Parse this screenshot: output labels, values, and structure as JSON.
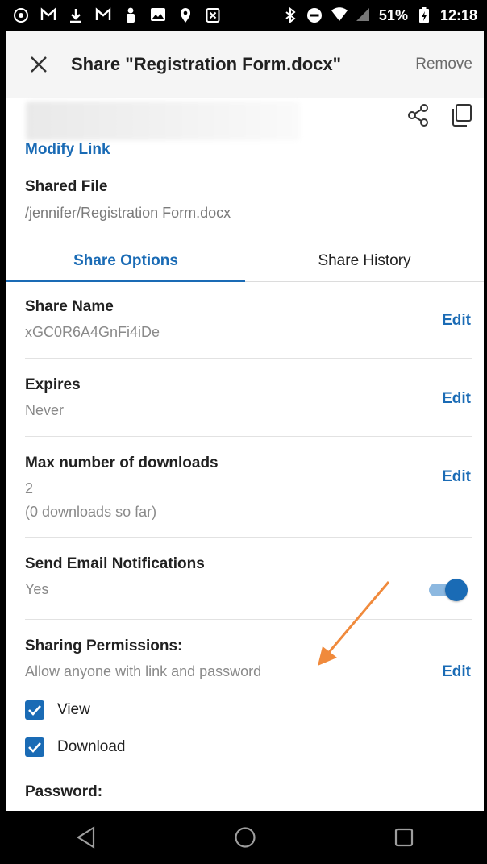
{
  "status_bar": {
    "battery": "51%",
    "time": "12:18",
    "left_icons": [
      "whatsapp-icon",
      "gmail-icon",
      "download-icon",
      "gmail-icon",
      "person-icon",
      "image-icon",
      "location-icon",
      "close-box-icon"
    ],
    "right_icons": [
      "bluetooth-icon",
      "do-not-disturb-icon",
      "wifi-icon",
      "signal-icon",
      "battery-icon"
    ]
  },
  "header": {
    "title": "Share \"Registration Form.docx\"",
    "remove_label": "Remove"
  },
  "link": {
    "modify_label": "Modify Link"
  },
  "shared_file": {
    "label": "Shared File",
    "path": "/jennifer/Registration Form.docx"
  },
  "tabs": [
    {
      "label": "Share Options",
      "active": true
    },
    {
      "label": "Share History",
      "active": false
    }
  ],
  "options": {
    "share_name": {
      "label": "Share Name",
      "value": "xGC0R6A4GnFi4iDe",
      "edit": "Edit"
    },
    "expires": {
      "label": "Expires",
      "value": "Never",
      "edit": "Edit"
    },
    "max_downloads": {
      "label": "Max number of downloads",
      "value": "2",
      "sub": "(0 downloads so far)",
      "edit": "Edit"
    },
    "email_notifications": {
      "label": "Send Email Notifications",
      "value": "Yes",
      "enabled": true
    },
    "permissions": {
      "label": "Sharing Permissions:",
      "value": "Allow anyone with link and password",
      "edit": "Edit"
    },
    "view": {
      "label": "View",
      "checked": true
    },
    "download": {
      "label": "Download",
      "checked": true
    },
    "password": {
      "label": "Password:"
    }
  },
  "colors": {
    "accent": "#1a6bb5",
    "annotation_arrow": "#f08a3c"
  }
}
